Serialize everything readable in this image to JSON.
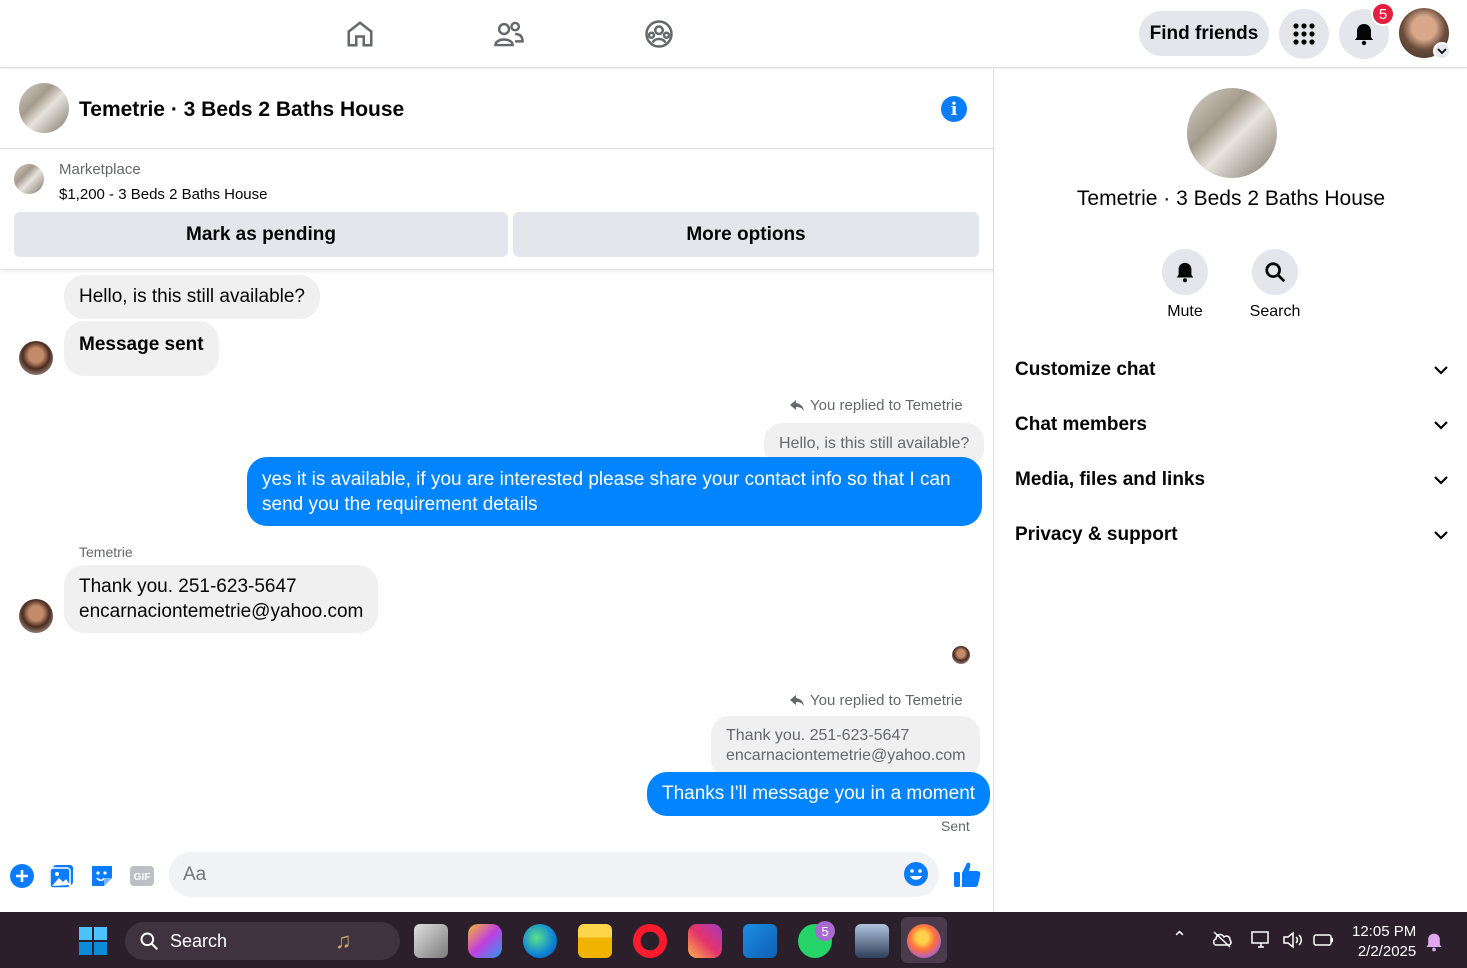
{
  "topbar": {
    "nav_icons": [
      "home-icon",
      "friends-icon",
      "groups-icon"
    ],
    "find_friends_label": "Find friends",
    "notification_count": "5"
  },
  "chat": {
    "title": "Temetrie · 3 Beds 2 Baths House",
    "marketplace": {
      "label": "Marketplace",
      "listing": "$1,200 - 3 Beds 2 Baths House",
      "mark_pending_label": "Mark as pending",
      "more_options_label": "More options"
    },
    "messages": {
      "m1": "Hello, is this still available?",
      "m2": "Message sent",
      "reply_note_1": "You replied to Temetrie",
      "quoted_1": "Hello, is this still available?",
      "out_1": "yes it is available, if you are interested please share your contact info so that I can send you the requirement details",
      "sender_name": "Temetrie",
      "in_2_line1": "Thank you. 251-623-5647",
      "in_2_line2": "encarnaciontemetrie@yahoo.com",
      "reply_note_2": "You replied to Temetrie",
      "quoted_2_line1": "Thank you. 251-623-5647",
      "quoted_2_line2": "encarnaciontemetrie@yahoo.com",
      "out_2": "Thanks I'll message you in a moment",
      "status": "Sent"
    },
    "composer": {
      "placeholder": "Aa"
    }
  },
  "sidebar": {
    "title": "Temetrie · 3 Beds 2 Baths House",
    "mute_label": "Mute",
    "search_label": "Search",
    "sections": [
      "Customize chat",
      "Chat members",
      "Media, files and links",
      "Privacy & support"
    ]
  },
  "taskbar": {
    "search_label": "Search",
    "whatsapp_badge": "5",
    "time": "12:05 PM",
    "date": "2/2/2025"
  },
  "colors": {
    "accent": "#0084ff",
    "badge": "#e41e3f",
    "taskbar": "#2b1f2b"
  }
}
